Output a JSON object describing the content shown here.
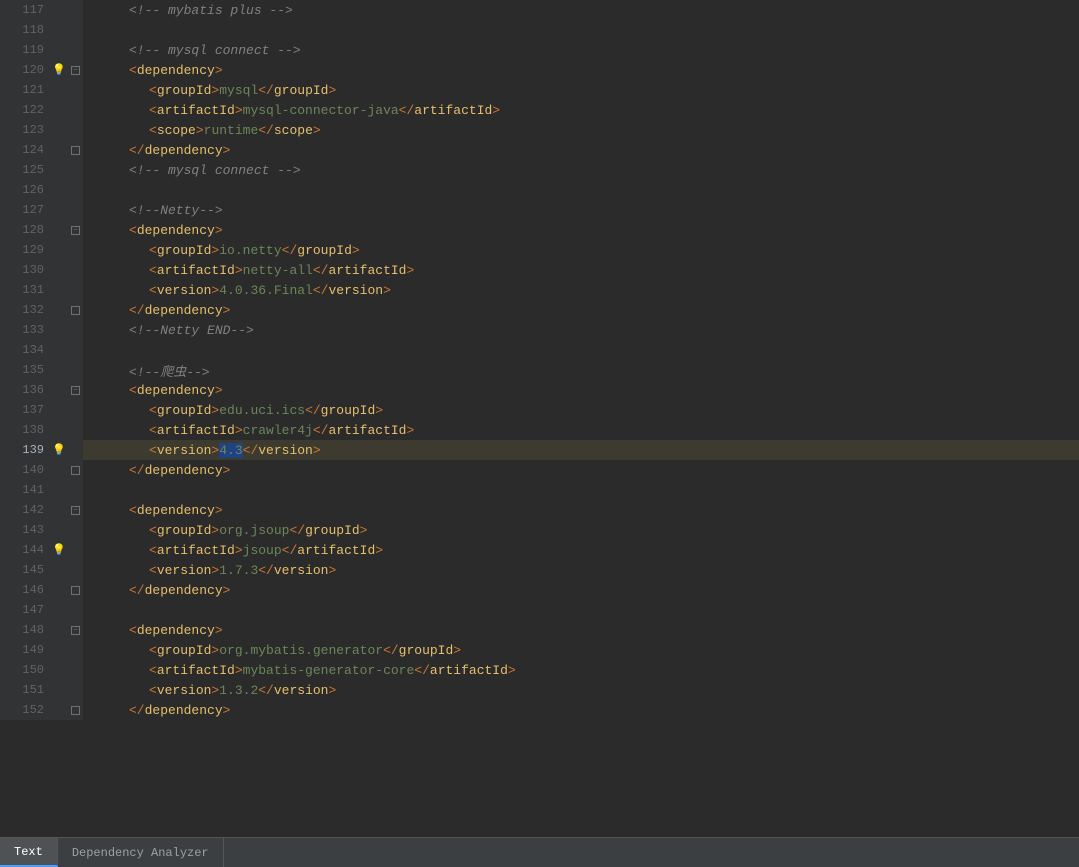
{
  "editor": {
    "lines": [
      {
        "num": 117,
        "indent": 2,
        "content": "",
        "type": "comment",
        "text": "<!-- mybatis plus -->",
        "fold": false,
        "hint": false,
        "highlight": false
      },
      {
        "num": 118,
        "indent": 0,
        "content": "",
        "type": "empty",
        "text": "",
        "fold": false,
        "hint": false,
        "highlight": false
      },
      {
        "num": 119,
        "indent": 2,
        "content": "",
        "type": "comment",
        "text": "<!-- mysql connect -->",
        "fold": false,
        "hint": false,
        "highlight": false
      },
      {
        "num": 120,
        "indent": 2,
        "content": "",
        "type": "tag_open",
        "tag": "dependency",
        "fold": true,
        "hint": true,
        "highlight": false
      },
      {
        "num": 121,
        "indent": 3,
        "content": "",
        "type": "tag_pair",
        "tag": "groupId",
        "value": "mysql",
        "fold": false,
        "hint": false,
        "highlight": false
      },
      {
        "num": 122,
        "indent": 3,
        "content": "",
        "type": "tag_pair",
        "tag": "artifactId",
        "value": "mysql-connector-java",
        "fold": false,
        "hint": false,
        "highlight": false
      },
      {
        "num": 123,
        "indent": 3,
        "content": "",
        "type": "tag_pair",
        "tag": "scope",
        "value": "runtime",
        "fold": false,
        "hint": false,
        "highlight": false
      },
      {
        "num": 124,
        "indent": 2,
        "content": "",
        "type": "tag_close",
        "tag": "dependency",
        "fold": true,
        "hint": false,
        "highlight": false
      },
      {
        "num": 125,
        "indent": 2,
        "content": "",
        "type": "comment",
        "text": "<!-- mysql connect -->",
        "fold": false,
        "hint": false,
        "highlight": false
      },
      {
        "num": 126,
        "indent": 0,
        "content": "",
        "type": "empty",
        "text": "",
        "fold": false,
        "hint": false,
        "highlight": false
      },
      {
        "num": 127,
        "indent": 2,
        "content": "",
        "type": "comment",
        "text": "<!--Netty-->",
        "fold": false,
        "hint": false,
        "highlight": false
      },
      {
        "num": 128,
        "indent": 2,
        "content": "",
        "type": "tag_open",
        "tag": "dependency",
        "fold": true,
        "hint": false,
        "highlight": false
      },
      {
        "num": 129,
        "indent": 3,
        "content": "",
        "type": "tag_pair",
        "tag": "groupId",
        "value": "io.netty",
        "fold": false,
        "hint": false,
        "highlight": false
      },
      {
        "num": 130,
        "indent": 3,
        "content": "",
        "type": "tag_pair",
        "tag": "artifactId",
        "value": "netty-all",
        "fold": false,
        "hint": false,
        "highlight": false
      },
      {
        "num": 131,
        "indent": 3,
        "content": "",
        "type": "tag_pair",
        "tag": "version",
        "value": "4.0.36.Final",
        "fold": false,
        "hint": false,
        "highlight": false
      },
      {
        "num": 132,
        "indent": 2,
        "content": "",
        "type": "tag_close",
        "tag": "dependency",
        "fold": true,
        "hint": false,
        "highlight": false
      },
      {
        "num": 133,
        "indent": 2,
        "content": "",
        "type": "comment",
        "text": "<!--Netty END-->",
        "fold": false,
        "hint": false,
        "highlight": false
      },
      {
        "num": 134,
        "indent": 0,
        "content": "",
        "type": "empty",
        "text": "",
        "fold": false,
        "hint": false,
        "highlight": false
      },
      {
        "num": 135,
        "indent": 2,
        "content": "",
        "type": "comment",
        "text": "<!--爬虫-->",
        "fold": false,
        "hint": false,
        "highlight": false
      },
      {
        "num": 136,
        "indent": 2,
        "content": "",
        "type": "tag_open",
        "tag": "dependency",
        "fold": true,
        "hint": false,
        "highlight": false
      },
      {
        "num": 137,
        "indent": 3,
        "content": "",
        "type": "tag_pair",
        "tag": "groupId",
        "value": "edu.uci.ics",
        "fold": false,
        "hint": false,
        "highlight": false
      },
      {
        "num": 138,
        "indent": 3,
        "content": "",
        "type": "tag_pair",
        "tag": "artifactId",
        "value": "crawler4j",
        "fold": false,
        "hint": false,
        "highlight": false
      },
      {
        "num": 139,
        "indent": 3,
        "content": "",
        "type": "tag_pair_selected",
        "tag": "version",
        "value": "4.3",
        "fold": false,
        "hint": true,
        "highlight": true
      },
      {
        "num": 140,
        "indent": 2,
        "content": "",
        "type": "tag_close",
        "tag": "dependency",
        "fold": true,
        "hint": false,
        "highlight": false
      },
      {
        "num": 141,
        "indent": 0,
        "content": "",
        "type": "empty",
        "text": "",
        "fold": false,
        "hint": false,
        "highlight": false
      },
      {
        "num": 142,
        "indent": 2,
        "content": "",
        "type": "tag_open",
        "tag": "dependency",
        "fold": true,
        "hint": false,
        "highlight": false
      },
      {
        "num": 143,
        "indent": 3,
        "content": "",
        "type": "tag_pair",
        "tag": "groupId",
        "value": "org.jsoup",
        "fold": false,
        "hint": false,
        "highlight": false
      },
      {
        "num": 144,
        "indent": 3,
        "content": "",
        "type": "tag_pair",
        "tag": "artifactId",
        "value": "jsoup",
        "fold": false,
        "hint": true,
        "highlight": false
      },
      {
        "num": 145,
        "indent": 3,
        "content": "",
        "type": "tag_pair",
        "tag": "version",
        "value": "1.7.3",
        "fold": false,
        "hint": false,
        "highlight": false
      },
      {
        "num": 146,
        "indent": 2,
        "content": "",
        "type": "tag_close",
        "tag": "dependency",
        "fold": true,
        "hint": false,
        "highlight": false
      },
      {
        "num": 147,
        "indent": 0,
        "content": "",
        "type": "empty",
        "text": "",
        "fold": false,
        "hint": false,
        "highlight": false
      },
      {
        "num": 148,
        "indent": 2,
        "content": "",
        "type": "tag_open",
        "tag": "dependency",
        "fold": true,
        "hint": false,
        "highlight": false
      },
      {
        "num": 149,
        "indent": 3,
        "content": "",
        "type": "tag_pair",
        "tag": "groupId",
        "value": "org.mybatis.generator",
        "fold": false,
        "hint": false,
        "highlight": false
      },
      {
        "num": 150,
        "indent": 3,
        "content": "",
        "type": "tag_pair",
        "tag": "artifactId",
        "value": "mybatis-generator-core",
        "fold": false,
        "hint": false,
        "highlight": false
      },
      {
        "num": 151,
        "indent": 3,
        "content": "",
        "type": "tag_pair",
        "tag": "version",
        "value": "1.3.2",
        "fold": false,
        "hint": false,
        "highlight": false
      },
      {
        "num": 152,
        "indent": 2,
        "content": "",
        "type": "tag_close",
        "tag": "dependency",
        "fold": true,
        "hint": false,
        "highlight": false
      }
    ]
  },
  "tabs": [
    {
      "label": "Text",
      "active": true
    },
    {
      "label": "Dependency Analyzer",
      "active": false
    }
  ]
}
